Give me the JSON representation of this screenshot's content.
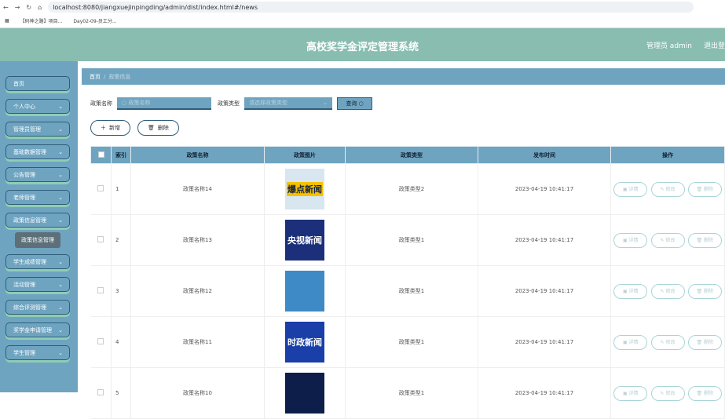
{
  "browser": {
    "url": "localhost:8080/jiangxuejinpingding/admin/dist/index.html#/news",
    "bookmarks": [
      "【码神之路】项目...",
      "Day02-09-员工分..."
    ]
  },
  "header": {
    "title": "高校奖学金评定管理系统",
    "user": "管理员 admin",
    "logout": "退出登"
  },
  "sidebar": {
    "items": [
      {
        "label": "首页",
        "chev": false
      },
      {
        "label": "个人中心",
        "chev": true
      },
      {
        "label": "管理员管理",
        "chev": true
      },
      {
        "label": "基础数据管理",
        "chev": true
      },
      {
        "label": "公告管理",
        "chev": true
      },
      {
        "label": "老师管理",
        "chev": true
      },
      {
        "label": "政策信息管理",
        "chev": true
      },
      {
        "label": "学生成绩管理",
        "chev": true
      },
      {
        "label": "活动管理",
        "chev": true
      },
      {
        "label": "综合评测管理",
        "chev": true
      },
      {
        "label": "奖学金申请管理",
        "chev": true
      },
      {
        "label": "学生管理",
        "chev": true
      }
    ],
    "sub_item": "政策信息管理"
  },
  "breadcrumb": {
    "home": "首页",
    "sep": "/",
    "current": "政策信息"
  },
  "search": {
    "name_label": "政策名称",
    "name_placeholder": "政策名称",
    "type_label": "政策类型",
    "type_placeholder": "请选择政策类型",
    "query": "查询"
  },
  "actions": {
    "add": "新增",
    "delete": "删除"
  },
  "table": {
    "headers": [
      "索引",
      "政策名称",
      "政策图片",
      "政策类型",
      "发布时间",
      "操作"
    ],
    "row_buttons": {
      "detail": "详情",
      "edit": "修改",
      "delete": "删除"
    },
    "rows": [
      {
        "index": "1",
        "name": "政策名称14",
        "image": "爆点新闻",
        "type": "政策类型2",
        "time": "2023-04-19 10:41:17",
        "color": "#d8e6f0"
      },
      {
        "index": "2",
        "name": "政策名称13",
        "image": "央视新闻",
        "type": "政策类型1",
        "time": "2023-04-19 10:41:17",
        "color": "#1b2f7a"
      },
      {
        "index": "3",
        "name": "政策名称12",
        "image": "",
        "type": "政策类型1",
        "time": "2023-04-19 10:41:17",
        "color": "#3d8ac7"
      },
      {
        "index": "4",
        "name": "政策名称11",
        "image": "时政新闻",
        "type": "政策类型1",
        "time": "2023-04-19 10:41:17",
        "color": "#1a3fa8"
      },
      {
        "index": "5",
        "name": "政策名称10",
        "image": "",
        "type": "政策类型1",
        "time": "2023-04-19 10:41:17",
        "color": "#0e1e4a"
      }
    ]
  }
}
